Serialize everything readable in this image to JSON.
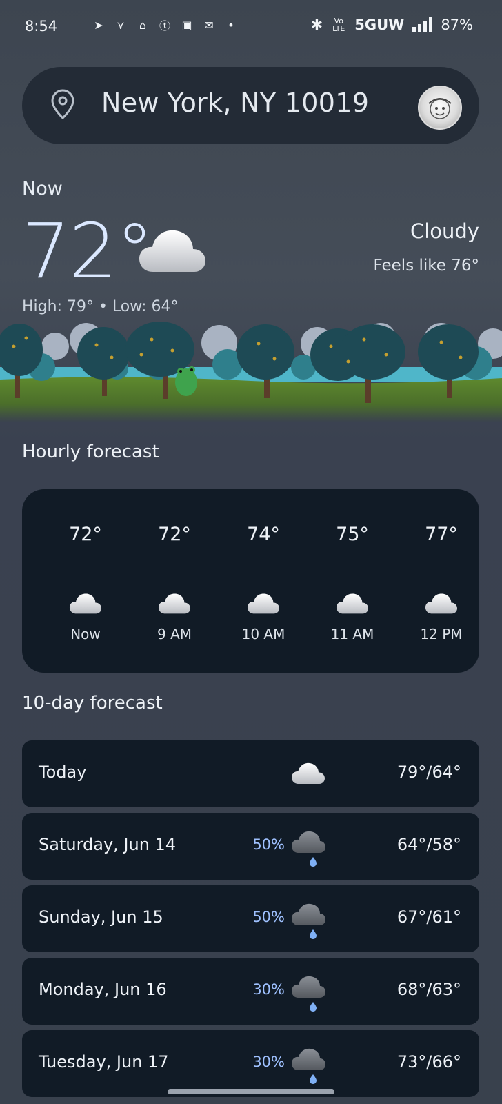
{
  "status_bar": {
    "time": "8:54",
    "network": "5GUW",
    "battery": "87%",
    "volte": "Vo LTE"
  },
  "search": {
    "location": "New York, NY 10019"
  },
  "current": {
    "label": "Now",
    "temperature": "72°",
    "condition": "Cloudy",
    "feels_like": "Feels like 76°",
    "high_low": "High: 79° • Low: 64°",
    "icon": "cloud-icon"
  },
  "hourly": {
    "title": "Hourly forecast",
    "items": [
      {
        "temp": "72°",
        "label": "Now",
        "icon": "cloud-icon"
      },
      {
        "temp": "72°",
        "label": "9 AM",
        "icon": "cloud-icon"
      },
      {
        "temp": "74°",
        "label": "10 AM",
        "icon": "cloud-icon"
      },
      {
        "temp": "75°",
        "label": "11 AM",
        "icon": "cloud-icon"
      },
      {
        "temp": "77°",
        "label": "12 PM",
        "icon": "cloud-icon"
      }
    ]
  },
  "daily": {
    "title": "10-day forecast",
    "items": [
      {
        "day": "Today",
        "precip": "",
        "range": "79°/64°",
        "icon": "cloud-icon"
      },
      {
        "day": "Saturday, Jun 14",
        "precip": "50%",
        "range": "64°/58°",
        "icon": "rain-cloud-icon"
      },
      {
        "day": "Sunday, Jun 15",
        "precip": "50%",
        "range": "67°/61°",
        "icon": "rain-cloud-icon"
      },
      {
        "day": "Monday, Jun 16",
        "precip": "30%",
        "range": "68°/63°",
        "icon": "rain-cloud-icon"
      },
      {
        "day": "Tuesday, Jun 17",
        "precip": "30%",
        "range": "73°/66°",
        "icon": "rain-cloud-icon"
      }
    ]
  },
  "colors": {
    "background": "#3d4550",
    "card": "#111b26",
    "search_bar": "#232b36",
    "temperature": "#dbe8ff",
    "precip": "#9fc1ff"
  }
}
